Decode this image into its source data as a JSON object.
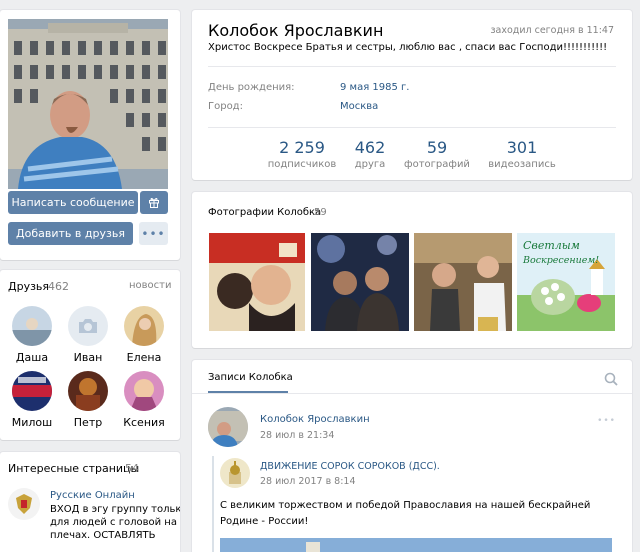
{
  "profile": {
    "name": "Колобок Ярославкин",
    "last_seen": "заходил сегодня в 11:47",
    "status": "Христос Воскресе Братья и сестры, люблю вас , спаси вас Господи!!!!!!!!!!!",
    "birthday_label": "День рождения:",
    "birthday_value": "9 мая 1985 г.",
    "city_label": "Город:",
    "city_value": "Москва"
  },
  "stats": [
    {
      "value": "2 259",
      "label": "подписчиков"
    },
    {
      "value": "462",
      "label": "друга"
    },
    {
      "value": "59",
      "label": "фотографий"
    },
    {
      "value": "301",
      "label": "видеозапись"
    }
  ],
  "actions": {
    "message": "Написать сообщение",
    "add_friend": "Добавить в друзья",
    "gift_icon": "gift-icon",
    "more_icon": "more-dots-icon"
  },
  "friends": {
    "title": "Друзья",
    "count": "462",
    "news_link": "новости",
    "items": [
      {
        "name": "Даша"
      },
      {
        "name": "Иван"
      },
      {
        "name": "Елена"
      },
      {
        "name": "Милош"
      },
      {
        "name": "Петр"
      },
      {
        "name": "Ксения"
      }
    ]
  },
  "interesting": {
    "title": "Интересные страницы",
    "count": "54",
    "item_name": "Русские Онлайн",
    "item_desc_1": "ВХОД в эгу группу только",
    "item_desc_2": "для людей с головой на",
    "item_desc_3": "плечах. ОСТАВЛЯТЬ"
  },
  "photos": {
    "title": "Фотографии Колобка",
    "count": "59",
    "photo4_line1": "Светлым",
    "photo4_line2": "Воскресением!"
  },
  "wall": {
    "tab": "Записи Колобка",
    "search_icon": "search-icon",
    "post_author": "Колобок Ярославкин",
    "post_time": "28 июл в 21:34",
    "repost_author": "ДВИЖЕНИЕ СОРОК СОРОКОВ (ДСС).",
    "repost_time": "28 июл 2017 в 8:14",
    "repost_text": "С великим торжеством и победой Православия на нашей бескрайней Родине - России!"
  },
  "colors": {
    "accent": "#5e81a8",
    "link": "#2a5885",
    "background": "#edeef0"
  }
}
